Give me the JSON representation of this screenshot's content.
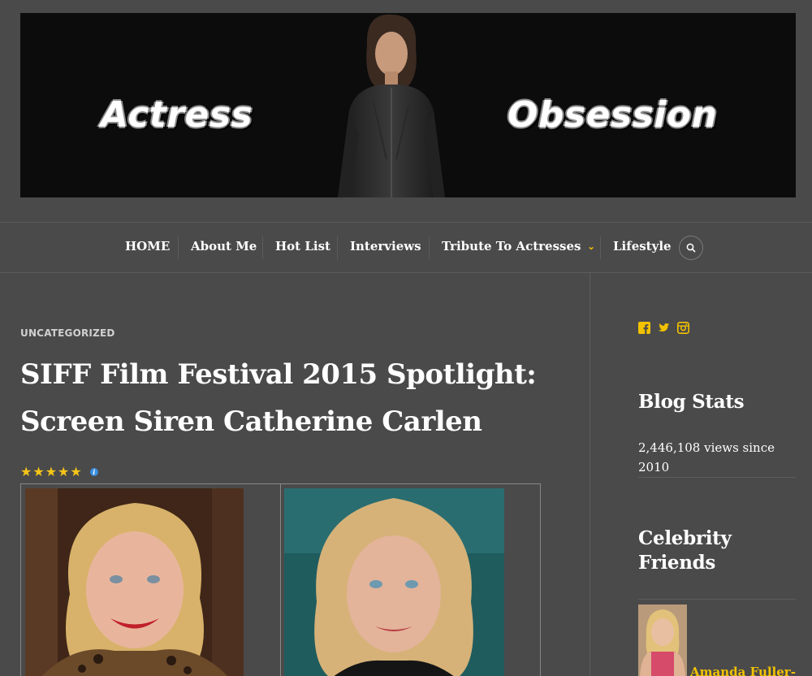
{
  "colors": {
    "background": "#4a4a4a",
    "accent": "#f2c200",
    "text": "#ffffff"
  },
  "banner": {
    "left_word": "Actress",
    "right_word": "Obsession"
  },
  "nav": {
    "items": [
      {
        "label": "HOME"
      },
      {
        "label": "About Me"
      },
      {
        "label": "Hot List"
      },
      {
        "label": "Interviews"
      },
      {
        "label": "Tribute To Actresses",
        "icon": "chevron-down-icon"
      },
      {
        "label": "Lifestyle"
      }
    ],
    "search_icon": "search-icon"
  },
  "post": {
    "category": "UNCATEGORIZED",
    "title": "SIFF Film Festival 2015 Spotlight: Screen Siren Catherine Carlen",
    "rating_stars": 5,
    "rating_info_icon": "info-icon"
  },
  "sidebar": {
    "social_icons": [
      "facebook-icon",
      "twitter-icon",
      "instagram-icon"
    ],
    "blog_stats": {
      "title": "Blog Stats",
      "text": "2,446,108 views since 2010"
    },
    "celebrity_friends": {
      "title": "Celebrity Friends",
      "first_friend": "Amanda Fuller-"
    }
  }
}
